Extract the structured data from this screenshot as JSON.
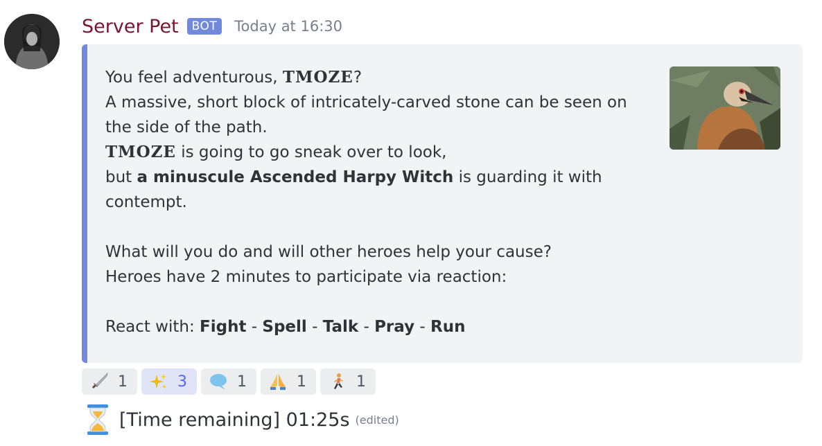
{
  "message": {
    "author": "Server Pet",
    "bot_tag": "BOT",
    "timestamp": "Today at 16:30"
  },
  "embed": {
    "player_name": "TMOZE",
    "line1_prefix": "You feel adventurous, ",
    "line1_suffix": "?",
    "line2": "A massive, short block of intricately-carved stone can be seen on the side of the path.",
    "line3_suffix": " is going to go sneak over to look,",
    "line4_prefix": "but ",
    "line4_bold": "a minuscule Ascended Harpy Witch",
    "line4_suffix": " is guarding it with contempt.",
    "line5": "What will you do and will other heroes help your cause?",
    "line6": "Heroes have 2 minutes to participate via reaction:",
    "react_prefix": "React with: ",
    "actions": [
      "Fight",
      "Spell",
      "Talk",
      "Pray",
      "Run"
    ],
    "separator": " - ",
    "thumbnail": "vulture-photo",
    "accent_color": "#7289da"
  },
  "reactions": [
    {
      "icon": "dagger-icon",
      "count": "1",
      "me": false
    },
    {
      "icon": "sparkles-icon",
      "count": "3",
      "me": true
    },
    {
      "icon": "speech-bubble-icon",
      "count": "1",
      "me": false
    },
    {
      "icon": "praying-hands-icon",
      "count": "1",
      "me": false
    },
    {
      "icon": "running-person-icon",
      "count": "1",
      "me": false
    }
  ],
  "footer": {
    "icon": "hourglass-icon",
    "text": "[Time remaining] 01:25s",
    "edited": "(edited)"
  }
}
